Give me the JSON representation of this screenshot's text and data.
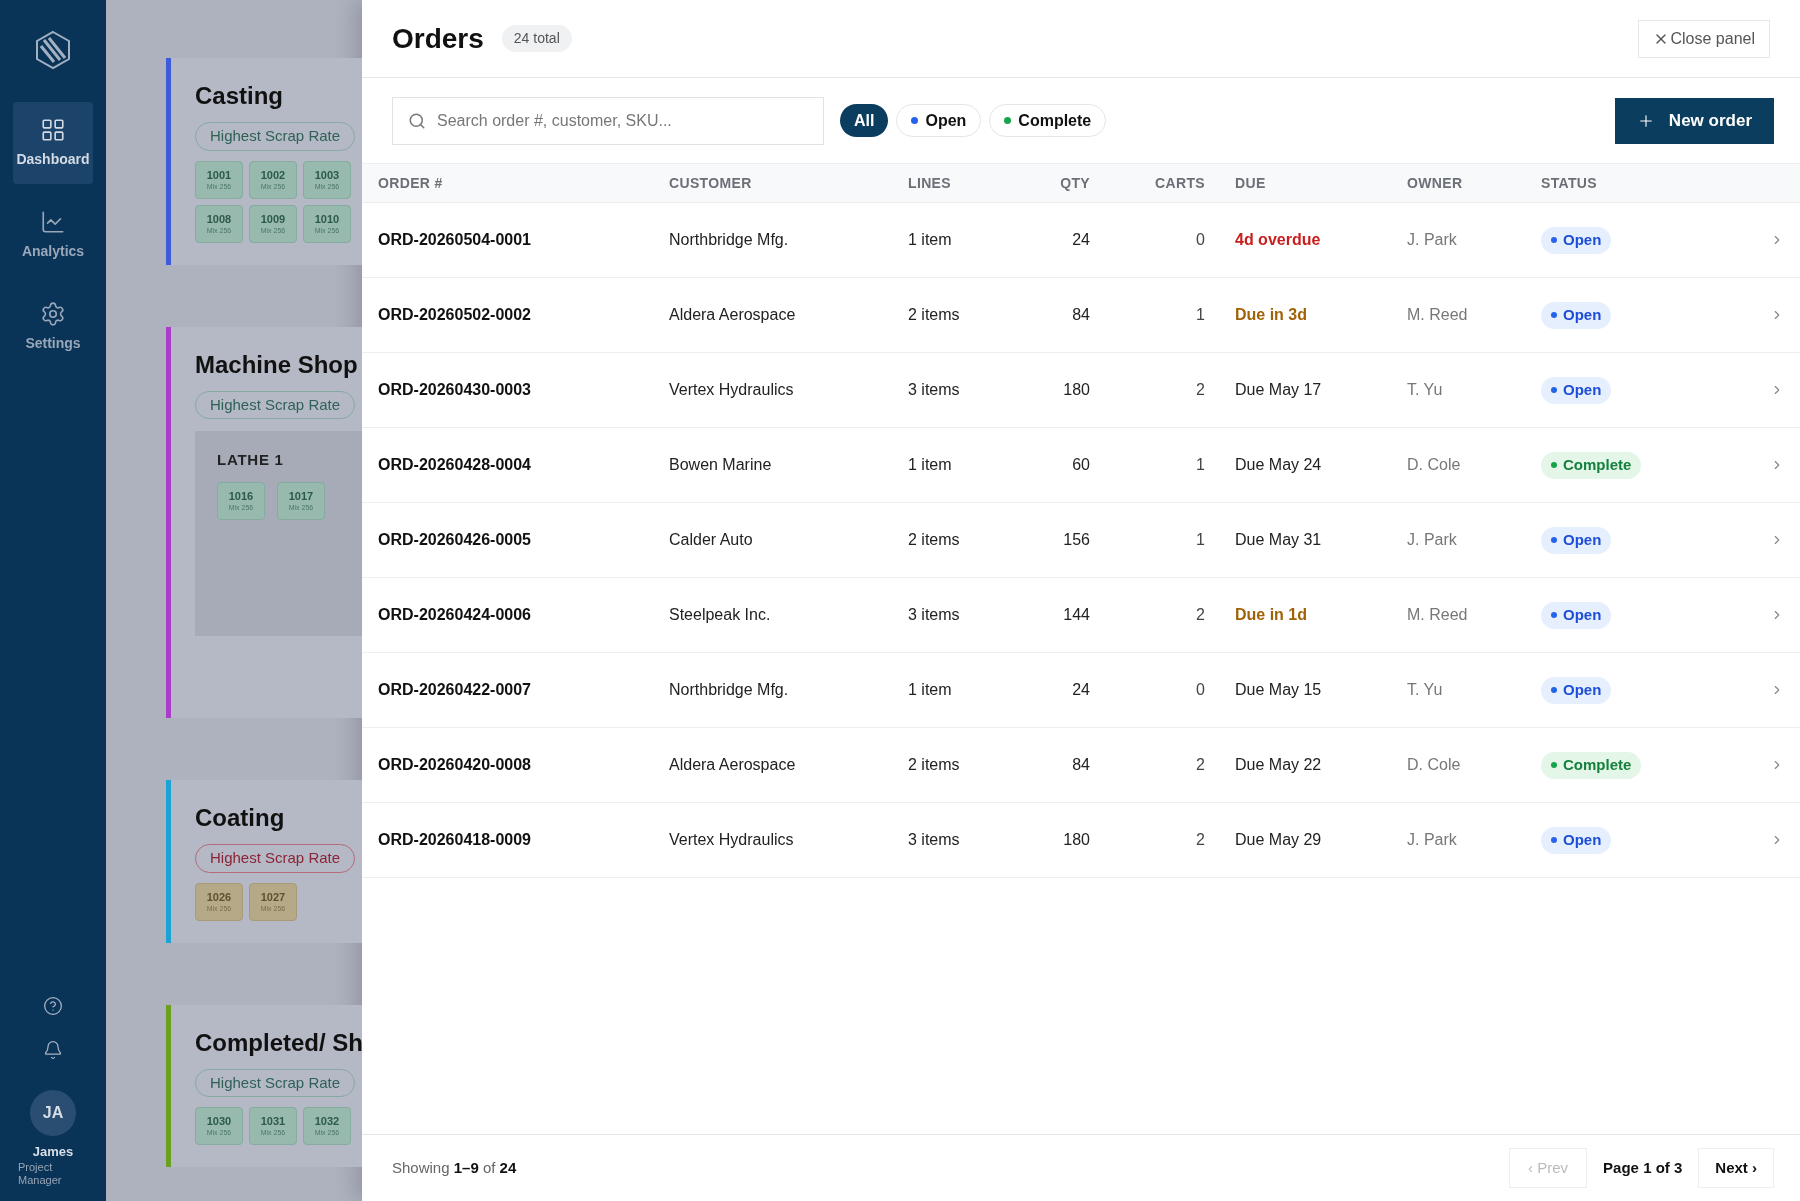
{
  "sidebar": {
    "nav": [
      {
        "label": "Dashboard",
        "selected": true
      },
      {
        "label": "Analytics",
        "selected": false
      },
      {
        "label": "Settings",
        "selected": false
      }
    ],
    "user": {
      "initials": "JA",
      "name": "James",
      "role": "Project Manager"
    }
  },
  "board": {
    "sections": [
      {
        "title": "Casting",
        "color": "#3b5bdb",
        "scrap": {
          "label": "Highest Scrap Rate",
          "kind": "normal"
        },
        "tiles": [
          {
            "number": "1001",
            "sub": "Mix 256",
            "kind": "ok"
          },
          {
            "number": "1002",
            "sub": "Mix 256",
            "kind": "ok"
          },
          {
            "number": "1003",
            "sub": "Mix 256",
            "kind": "ok"
          },
          {
            "number": "1008",
            "sub": "Mix 256",
            "kind": "ok"
          },
          {
            "number": "1009",
            "sub": "Mix 256",
            "kind": "ok"
          },
          {
            "number": "1010",
            "sub": "Mix 256",
            "kind": "ok"
          }
        ]
      },
      {
        "title": "Machine Shop",
        "color": "#a93cc9",
        "scrap": {
          "label": "Highest Scrap Rate",
          "kind": "normal"
        },
        "stations": [
          {
            "name": "LATHE 1",
            "tiles": [
              {
                "number": "1016",
                "sub": "Mix 256",
                "kind": "ok"
              },
              {
                "number": "1017",
                "sub": "Mix 256",
                "kind": "ok"
              }
            ]
          }
        ]
      },
      {
        "title": "Coating",
        "color": "#1ba3d6",
        "scrap": {
          "label": "Highest Scrap Rate",
          "kind": "alert"
        },
        "tiles": [
          {
            "number": "1026",
            "sub": "Mix 256",
            "kind": "warn"
          },
          {
            "number": "1027",
            "sub": "Mix 256",
            "kind": "warn"
          }
        ]
      },
      {
        "title": "Completed/ Sh",
        "color": "#6aa11f",
        "scrap": {
          "label": "Highest Scrap Rate",
          "kind": "normal"
        },
        "tiles": [
          {
            "number": "1030",
            "sub": "Mix 256",
            "kind": "ok"
          },
          {
            "number": "1031",
            "sub": "Mix 256",
            "kind": "ok"
          },
          {
            "number": "1032",
            "sub": "Mix 256",
            "kind": "ok"
          }
        ]
      }
    ]
  },
  "panel": {
    "title": "Orders",
    "count": "24 total",
    "close_label": "Close panel",
    "search": {
      "placeholder": "Search order #, customer, SKU..."
    },
    "filters": [
      {
        "label": "All",
        "selected": true
      },
      {
        "label": "Open",
        "selected": false,
        "color": "#2563eb"
      },
      {
        "label": "Complete",
        "selected": false,
        "color": "#16a34a"
      }
    ],
    "new_order": "New order",
    "columns": [
      "ORDER #",
      "CUSTOMER",
      "LINES",
      "QTY",
      "CARTS",
      "DUE",
      "OWNER",
      "STATUS"
    ],
    "rows": [
      {
        "order": "ORD-20260504-0001",
        "customer": "Northbridge Mfg.",
        "lines": "1 item",
        "qty": "24",
        "carts": "0",
        "due": {
          "text": "4d overdue",
          "kind": "overdue"
        },
        "owner": "J. Park",
        "status": {
          "text": "Open",
          "kind": "open"
        }
      },
      {
        "order": "ORD-20260502-0002",
        "customer": "Aldera Aerospace",
        "lines": "2 items",
        "qty": "84",
        "carts": "1",
        "due": {
          "text": "Due in 3d",
          "kind": "soon"
        },
        "owner": "M. Reed",
        "status": {
          "text": "Open",
          "kind": "open"
        }
      },
      {
        "order": "ORD-20260430-0003",
        "customer": "Vertex Hydraulics",
        "lines": "3 items",
        "qty": "180",
        "carts": "2",
        "due": {
          "text": "Due May 17",
          "kind": "normal"
        },
        "owner": "T. Yu",
        "status": {
          "text": "Open",
          "kind": "open"
        }
      },
      {
        "order": "ORD-20260428-0004",
        "customer": "Bowen Marine",
        "lines": "1 item",
        "qty": "60",
        "carts": "1",
        "due": {
          "text": "Due May 24",
          "kind": "normal"
        },
        "owner": "D. Cole",
        "status": {
          "text": "Complete",
          "kind": "complete"
        }
      },
      {
        "order": "ORD-20260426-0005",
        "customer": "Calder Auto",
        "lines": "2 items",
        "qty": "156",
        "carts": "1",
        "due": {
          "text": "Due May 31",
          "kind": "normal"
        },
        "owner": "J. Park",
        "status": {
          "text": "Open",
          "kind": "open"
        }
      },
      {
        "order": "ORD-20260424-0006",
        "customer": "Steelpeak Inc.",
        "lines": "3 items",
        "qty": "144",
        "carts": "2",
        "due": {
          "text": "Due in 1d",
          "kind": "soon"
        },
        "owner": "M. Reed",
        "status": {
          "text": "Open",
          "kind": "open"
        }
      },
      {
        "order": "ORD-20260422-0007",
        "customer": "Northbridge Mfg.",
        "lines": "1 item",
        "qty": "24",
        "carts": "0",
        "due": {
          "text": "Due May 15",
          "kind": "normal"
        },
        "owner": "T. Yu",
        "status": {
          "text": "Open",
          "kind": "open"
        }
      },
      {
        "order": "ORD-20260420-0008",
        "customer": "Aldera Aerospace",
        "lines": "2 items",
        "qty": "84",
        "carts": "2",
        "due": {
          "text": "Due May 22",
          "kind": "normal"
        },
        "owner": "D. Cole",
        "status": {
          "text": "Complete",
          "kind": "complete"
        }
      },
      {
        "order": "ORD-20260418-0009",
        "customer": "Vertex Hydraulics",
        "lines": "3 items",
        "qty": "180",
        "carts": "2",
        "due": {
          "text": "Due May 29",
          "kind": "normal"
        },
        "owner": "J. Park",
        "status": {
          "text": "Open",
          "kind": "open"
        }
      }
    ],
    "footer": {
      "showing": "Showing **1–9** of **24**",
      "prev": {
        "label": "‹ Prev",
        "disabled": true
      },
      "page": "Page 1 of 3",
      "next": {
        "label": "Next ›",
        "disabled": false
      }
    }
  }
}
